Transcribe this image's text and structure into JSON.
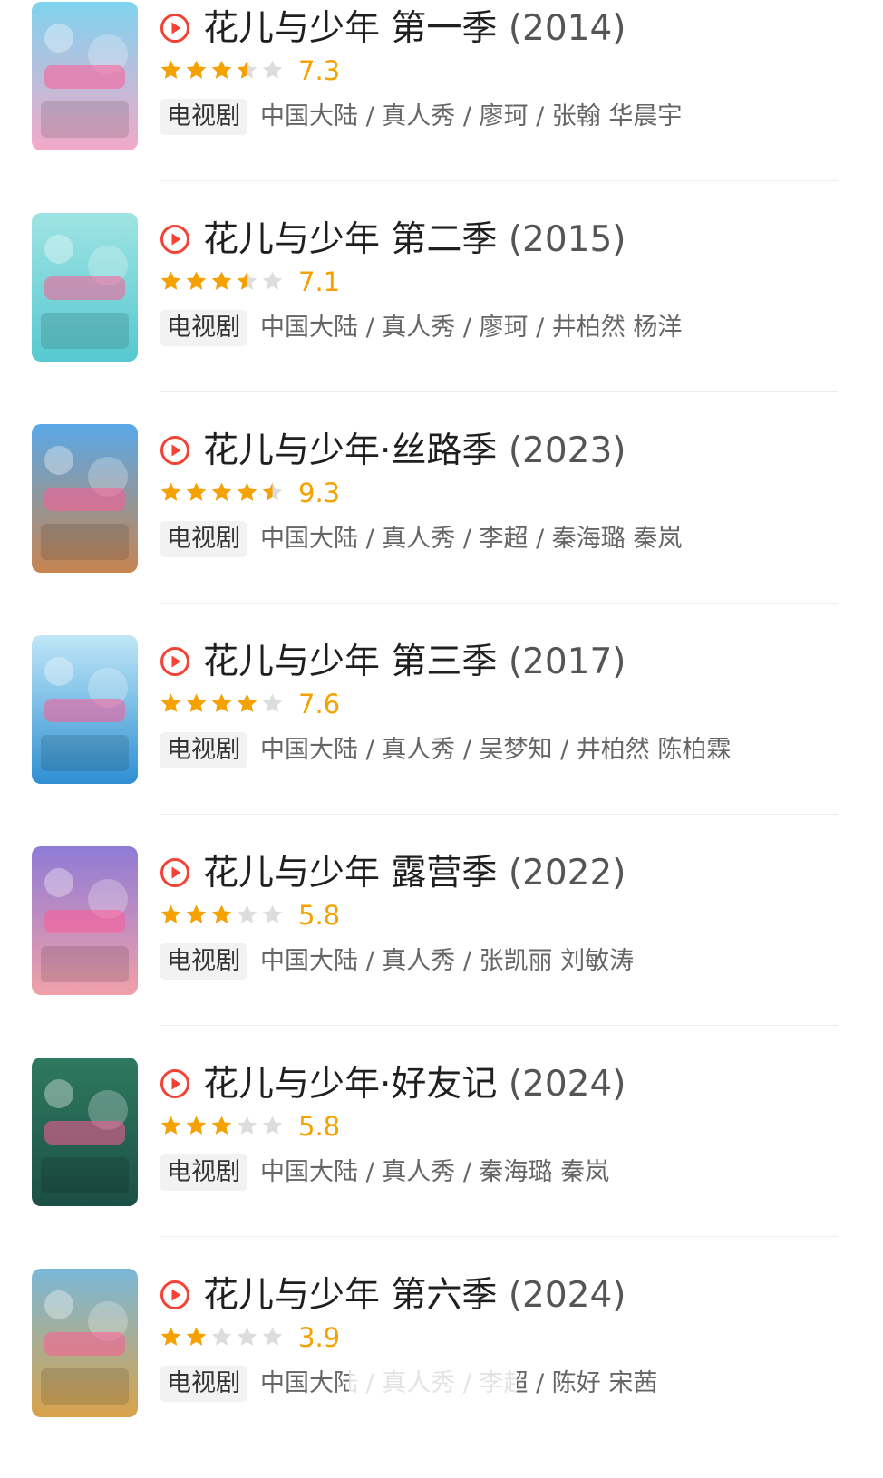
{
  "colors": {
    "accent_red": "#f24336",
    "star_filled": "#f5a100",
    "star_empty": "#dddddd",
    "title": "#1f1f1f",
    "meta": "#666666",
    "tag_bg": "#f2f2f2"
  },
  "items": [
    {
      "title": "花儿与少年 第一季",
      "year": "(2014)",
      "stars": 3.5,
      "score": "7.3",
      "tag": "电视剧",
      "meta": "中国大陆 / 真人秀 / 廖珂 / 张翰 华晨宇",
      "poster_colors": [
        "#7fd3ef",
        "#f3a9c8"
      ]
    },
    {
      "title": "花儿与少年 第二季",
      "year": "(2015)",
      "stars": 3.5,
      "score": "7.1",
      "tag": "电视剧",
      "meta": "中国大陆 / 真人秀 / 廖珂 / 井柏然 杨洋",
      "poster_colors": [
        "#9fe3e3",
        "#56c9d0"
      ]
    },
    {
      "title": "花儿与少年·丝路季",
      "year": "(2023)",
      "stars": 4.5,
      "score": "9.3",
      "tag": "电视剧",
      "meta": "中国大陆 / 真人秀 / 李超 / 秦海璐 秦岚",
      "poster_colors": [
        "#5aa9e8",
        "#c78451"
      ]
    },
    {
      "title": "花儿与少年 第三季",
      "year": "(2017)",
      "stars": 4,
      "score": "7.6",
      "tag": "电视剧",
      "meta": "中国大陆 / 真人秀 / 吴梦知 / 井柏然 陈柏霖",
      "poster_colors": [
        "#bfe7f7",
        "#2f8fd2"
      ]
    },
    {
      "title": "花儿与少年 露营季",
      "year": "(2022)",
      "stars": 3,
      "score": "5.8",
      "tag": "电视剧",
      "meta": "中国大陆 / 真人秀 / 张凯丽 刘敏涛",
      "poster_colors": [
        "#8f7bd6",
        "#f1a0a8"
      ]
    },
    {
      "title": "花儿与少年·好友记",
      "year": "(2024)",
      "stars": 3,
      "score": "5.8",
      "tag": "电视剧",
      "meta": "中国大陆 / 真人秀 / 秦海璐 秦岚",
      "poster_colors": [
        "#2f7a5f",
        "#1c4f45"
      ]
    },
    {
      "title": "花儿与少年 第六季",
      "year": "(2024)",
      "stars": 2,
      "score": "3.9",
      "tag": "电视剧",
      "meta": "中国大陆 / 真人秀 / 李超 / 陈好 宋茜",
      "poster_colors": [
        "#7ab8d8",
        "#d9a24a"
      ]
    }
  ]
}
